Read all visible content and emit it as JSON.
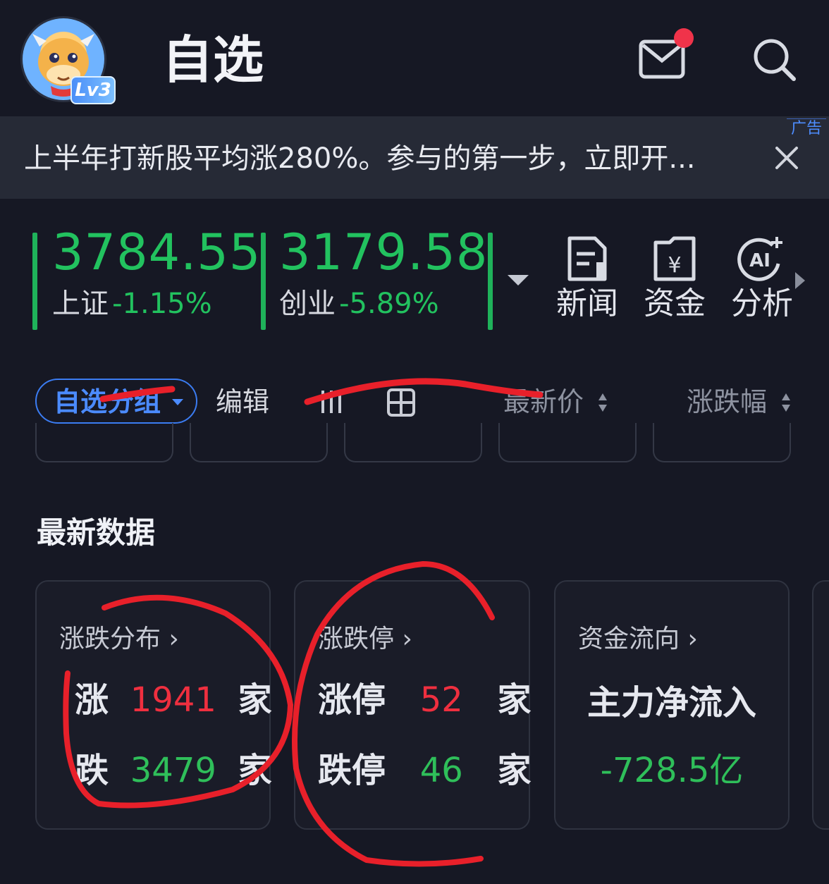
{
  "header": {
    "title": "自选",
    "level_badge": "Lv3"
  },
  "ad": {
    "text": "上半年打新股平均涨280%。参与的第一步，立即开...",
    "tag": "广告"
  },
  "indices": [
    {
      "value": "3784.55",
      "name": "上证",
      "change": "-1.15%"
    },
    {
      "value": "3179.58",
      "name": "创业",
      "change": "-5.89%"
    }
  ],
  "tools": [
    {
      "label": "新闻",
      "icon": "news-icon"
    },
    {
      "label": "资金",
      "icon": "yuan-doc-icon"
    },
    {
      "label": "分析",
      "icon": "ai-icon"
    }
  ],
  "toolbar": {
    "group_label": "自选分组",
    "edit_label": "编辑",
    "latest_price": "最新价",
    "change_pct": "涨跌幅"
  },
  "section": {
    "title": "最新数据"
  },
  "cards": {
    "dist": {
      "title": "涨跌分布",
      "up_label": "涨",
      "up_value": "1941",
      "down_label": "跌",
      "down_value": "3479",
      "unit": "家"
    },
    "limit": {
      "title": "涨跌停",
      "up_label": "涨停",
      "up_value": "52",
      "down_label": "跌停",
      "down_value": "46",
      "unit": "家"
    },
    "flow": {
      "title": "资金流向",
      "label": "主力净流入",
      "value": "-728.5亿"
    }
  },
  "colors": {
    "up": "#ef2f3f",
    "down": "#2fbf5a",
    "accent": "#3b7cf2",
    "annotation": "#e8202a"
  }
}
